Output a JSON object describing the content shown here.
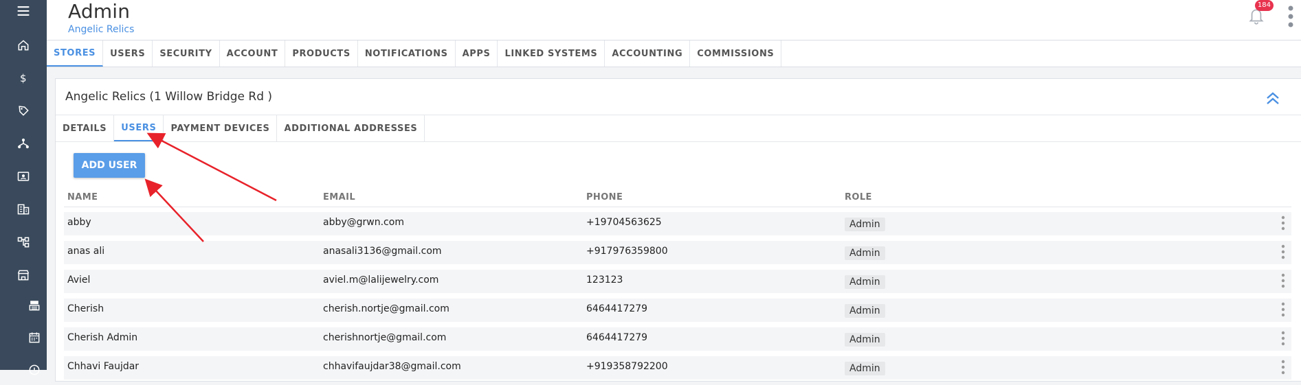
{
  "header": {
    "title": "Admin",
    "subtitle": "Angelic Relics",
    "notification_count": "184"
  },
  "sidebar": {
    "items": [
      {
        "icon": "menu-icon"
      },
      {
        "icon": "home-icon"
      },
      {
        "icon": "dollar-icon"
      },
      {
        "icon": "tag-icon"
      },
      {
        "icon": "network-icon"
      },
      {
        "icon": "contact-card-icon"
      },
      {
        "icon": "building-icon"
      },
      {
        "icon": "hierarchy-icon"
      },
      {
        "icon": "store-icon"
      },
      {
        "icon": "register-icon"
      },
      {
        "icon": "calendar-icon"
      },
      {
        "icon": "clock-icon"
      }
    ]
  },
  "main_tabs": [
    "STORES",
    "USERS",
    "SECURITY",
    "ACCOUNT",
    "PRODUCTS",
    "NOTIFICATIONS",
    "APPS",
    "LINKED SYSTEMS",
    "ACCOUNTING",
    "COMMISSIONS"
  ],
  "main_tab_active": "STORES",
  "card": {
    "title": "Angelic Relics (1 Willow Bridge Rd )",
    "sub_tabs": [
      "DETAILS",
      "USERS",
      "PAYMENT DEVICES",
      "ADDITIONAL ADDRESSES"
    ],
    "sub_tab_active": "USERS",
    "add_user_label": "ADD USER"
  },
  "table": {
    "headers": [
      "NAME",
      "EMAIL",
      "PHONE",
      "ROLE"
    ],
    "rows": [
      {
        "name": "abby",
        "email": "abby@grwn.com",
        "phone": "+19704563625",
        "role": "Admin"
      },
      {
        "name": "anas ali",
        "email": "anasali3136@gmail.com",
        "phone": "+917976359800",
        "role": "Admin"
      },
      {
        "name": "Aviel",
        "email": "aviel.m@lalijewelry.com",
        "phone": "123123",
        "role": "Admin"
      },
      {
        "name": "Cherish",
        "email": "cherish.nortje@gmail.com",
        "phone": "6464417279",
        "role": "Admin"
      },
      {
        "name": "Cherish Admin",
        "email": "cherishnortje@gmail.com",
        "phone": "6464417279",
        "role": "Admin"
      },
      {
        "name": "Chhavi Faujdar",
        "email": "chhavifaujdar38@gmail.com",
        "phone": "+919358792200",
        "role": "Admin"
      }
    ]
  },
  "colors": {
    "sidebar": "#3a4a5c",
    "accent": "#4a90e2",
    "button": "#5a9de8",
    "badge": "#e8334f",
    "annotation": "#e8222a"
  }
}
